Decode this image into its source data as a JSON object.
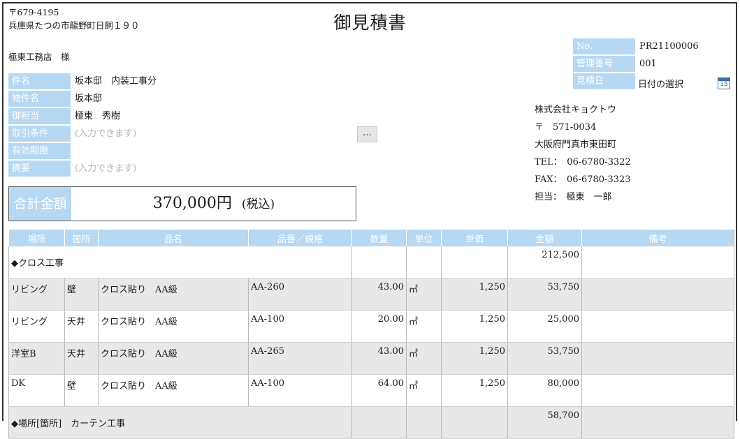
{
  "document": {
    "title": "御見積書",
    "postal": "〒679-4195",
    "address": "兵庫県たつの市龍野町日飼１９０",
    "recipient": "極東工務店　様"
  },
  "fields": [
    {
      "label": "件名",
      "value": "坂本邸　内装工事分",
      "placeholder": false
    },
    {
      "label": "物件名",
      "value": "坂本邸",
      "placeholder": false
    },
    {
      "label": "御担当",
      "value": "極東　秀樹",
      "placeholder": false
    },
    {
      "label": "取引条件",
      "value": "(入力できます)",
      "placeholder": true
    },
    {
      "label": "有効期限",
      "value": "",
      "placeholder": false
    },
    {
      "label": "摘要",
      "value": "(入力できます)",
      "placeholder": true
    }
  ],
  "more_button": "…",
  "total": {
    "label": "合計金額",
    "amount": "370,000円",
    "tax_note": "(税込)"
  },
  "meta": [
    {
      "label": "No.",
      "value": "PR21100006"
    },
    {
      "label": "管理番号",
      "value": "001"
    },
    {
      "label": "見積日",
      "value": "日付の選択"
    }
  ],
  "calendar_icon_text": "15",
  "company": {
    "name": "株式会社キョクトウ",
    "postal": "〒　571-0034",
    "address": "大阪府門真市東田町",
    "tel": "TEL：　06-6780-3322",
    "fax": "FAX：　06-6780-3323",
    "contact": "担当：　極東　一郎"
  },
  "table": {
    "headers": [
      "場所",
      "箇所",
      "品名",
      "品番／規格",
      "数量",
      "単位",
      "単価",
      "金額",
      "備考"
    ],
    "rows": [
      {
        "type": "group",
        "name": "◆クロス工事",
        "amount": "212,500"
      },
      {
        "type": "item",
        "place": "リビング",
        "spot": "壁",
        "item": "クロス貼り　AA級",
        "code": "AA-260",
        "qty": "43.00",
        "unit": "㎡",
        "price": "1,250",
        "amount": "53,750",
        "note": ""
      },
      {
        "type": "item",
        "place": "リビング",
        "spot": "天井",
        "item": "クロス貼り　AA級",
        "code": "AA-100",
        "qty": "20.00",
        "unit": "㎡",
        "price": "1,250",
        "amount": "25,000",
        "note": ""
      },
      {
        "type": "item",
        "place": "洋室B",
        "spot": "天井",
        "item": "クロス貼り　AA級",
        "code": "AA-265",
        "qty": "43.00",
        "unit": "㎡",
        "price": "1,250",
        "amount": "53,750",
        "note": ""
      },
      {
        "type": "item",
        "place": "DK",
        "spot": "壁",
        "item": "クロス貼り　AA級",
        "code": "AA-100",
        "qty": "64.00",
        "unit": "㎡",
        "price": "1,250",
        "amount": "80,000",
        "note": ""
      },
      {
        "type": "group",
        "name": "◆場所[箇所]　カーテン工事",
        "amount": "58,700"
      }
    ]
  },
  "colors": {
    "header_blue": "#b6d8f2",
    "row_alt": "#e8e8e8"
  }
}
